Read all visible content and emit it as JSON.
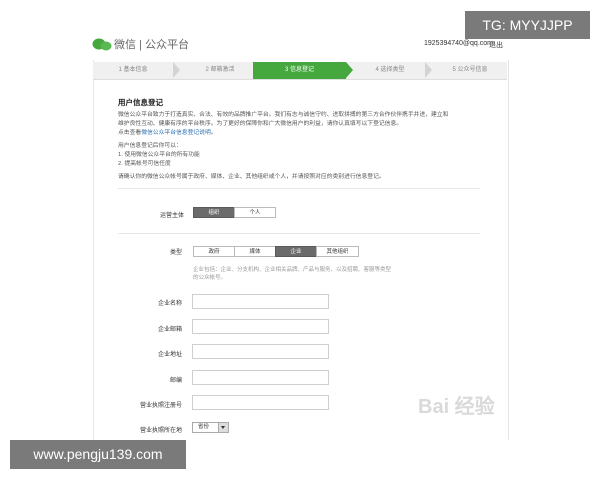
{
  "header": {
    "logo_text": "微信 | 公众平台",
    "user_email": "1925394740@qq.com",
    "logout_label": "退出"
  },
  "steps": [
    {
      "label": "1 基本信息",
      "active": false
    },
    {
      "label": "2 邮箱激活",
      "active": false
    },
    {
      "label": "3 信息登记",
      "active": true
    },
    {
      "label": "4 选择类型",
      "active": false
    },
    {
      "label": "5 公众号信息",
      "active": false
    }
  ],
  "intro": {
    "title": "用户信息登记",
    "line1": "微信公众平台致力于打造真实、合法、有效的品牌推广平台。我们有志与诚信守约、进取拼搏的第三方合作伙伴携手并进，建立和",
    "line2": "维护良性互动、健康有序的平台秩序。为了更好的保障你和广大微信用户的利益，请你认真填写以下登记信息。",
    "line3_prefix": "点击查看",
    "line3_link": "微信公众平台信息登记说明",
    "line3_suffix": "。",
    "benefits_title": "用户信息登记后你可以：",
    "benefit1": "1. 使用微信公众平台的所有功能",
    "benefit2": "2. 提高帐号可信任度",
    "instruction": "请确认你的微信公众帐号属于政府、媒体、企业、其他组织或个人，并请按照对应的类别进行信息登记。"
  },
  "operator": {
    "label": "运营主体",
    "options": [
      "组织",
      "个人"
    ],
    "selected": "组织"
  },
  "type": {
    "label": "类型",
    "options": [
      "政府",
      "媒体",
      "企业",
      "其他组织"
    ],
    "selected": "企业",
    "hint1": "企业包括：企业、分支机构、企业相关品牌、产品与服务、以及招聘、客服等类型",
    "hint2": "的公众帐号。"
  },
  "fields": {
    "company_name": "企业名称",
    "company_email": "企业邮箱",
    "company_address": "企业地址",
    "postal_code": "邮编",
    "license_number": "营业执照注册号",
    "license_location": "营业执照所在地",
    "province_select": "省份"
  },
  "overlays": {
    "tg": "TG: MYYJJPP",
    "site": "www.pengju139.com",
    "watermark": "Bai 经验"
  },
  "colors": {
    "accent": "#44a83f",
    "segment_selected": "#6b6b6b",
    "link": "#2a6fb0"
  }
}
